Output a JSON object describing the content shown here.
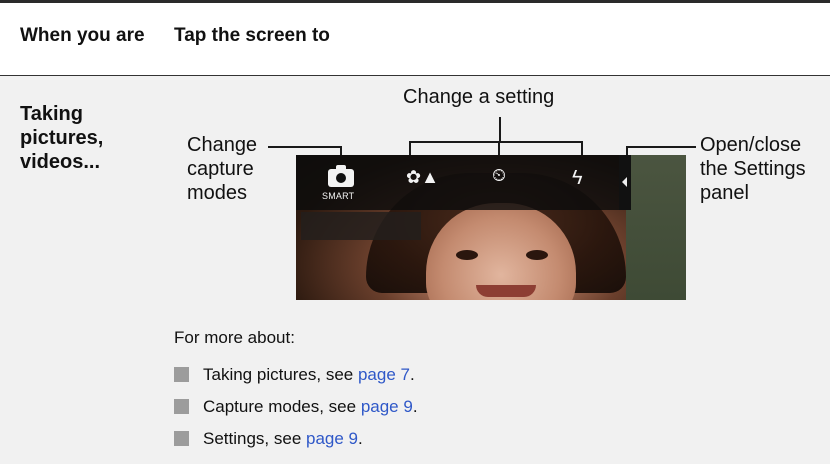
{
  "table": {
    "col1_header": "When you are",
    "col2_header": "Tap the screen to"
  },
  "row": {
    "label": "Taking pictures, videos..."
  },
  "callouts": {
    "change_setting": "Change a setting",
    "change_capture": "Change capture modes",
    "open_settings": "Open/close the Settings panel"
  },
  "photo": {
    "smart_label": "SMART"
  },
  "more": {
    "intro": "For more about:",
    "items": [
      {
        "text": "Taking pictures, see ",
        "link": "page 7",
        "end": "."
      },
      {
        "text": "Capture modes, see ",
        "link": "page 9",
        "end": "."
      },
      {
        "text": "Settings, see ",
        "link": "page 9",
        "end": "."
      }
    ]
  },
  "colors": {
    "link": "#2f58c8",
    "row_bg": "#f1f1f1",
    "bullet": "#9c9c9c"
  }
}
